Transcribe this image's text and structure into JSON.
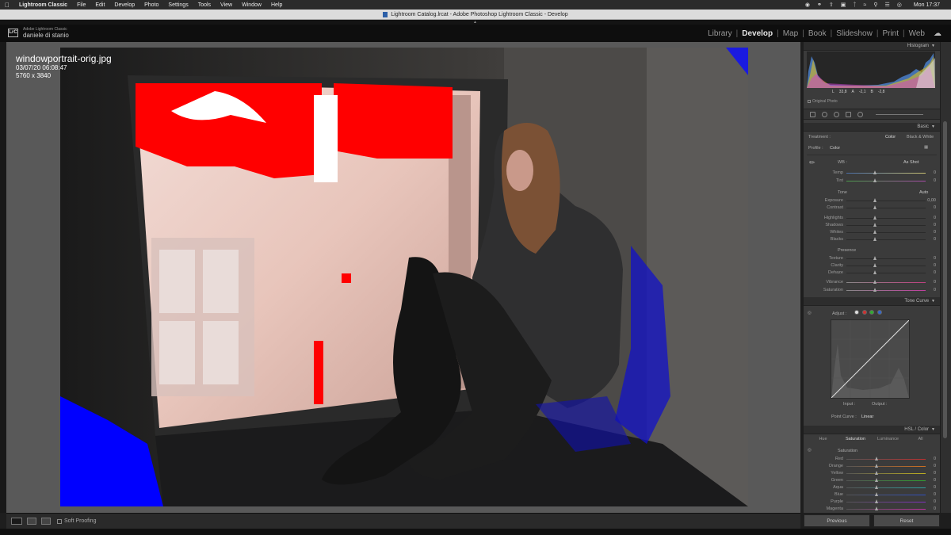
{
  "menubar": {
    "app": "Lightroom Classic",
    "items": [
      "File",
      "Edit",
      "Develop",
      "Photo",
      "Settings",
      "Tools",
      "View",
      "Window",
      "Help"
    ],
    "clock": "Mon 17:37"
  },
  "window": {
    "title": "Lightroom Catalog.lrcat - Adobe Photoshop Lightroom Classic - Develop"
  },
  "identity": {
    "badge": "LrC",
    "product": "Adobe Lightroom Classic",
    "user": "daniele di stanio"
  },
  "modules": [
    "Library",
    "Develop",
    "Map",
    "Book",
    "Slideshow",
    "Print",
    "Web"
  ],
  "active_module": "Develop",
  "photo_info": {
    "filename": "windowportrait-orig.jpg",
    "datetime": "03/07/20 06:08:47",
    "dimensions": "5760 x 3840"
  },
  "toolbar": {
    "soft_proofing": "Soft Proofing"
  },
  "histogram": {
    "title": "Histogram",
    "l_label": "L",
    "l_value": "33,8",
    "a_label": "A",
    "a_value": "-2,1",
    "b_label": "B",
    "b_value": "-2,8",
    "original_photo": "Original Photo"
  },
  "basic": {
    "title": "Basic",
    "treatment_label": "Treatment :",
    "treatment_color": "Color",
    "treatment_bw": "Black & White",
    "profile_label": "Profile :",
    "profile_value": "Color",
    "wb_label": "WB :",
    "wb_value": "As Shot",
    "tone_label": "Tone",
    "auto_label": "Auto",
    "presence_label": "Presence",
    "sliders": [
      {
        "label": "Temp",
        "value": "0"
      },
      {
        "label": "Tint",
        "value": "0"
      },
      {
        "label": "Exposure",
        "value": "0,00"
      },
      {
        "label": "Contrast",
        "value": "0"
      },
      {
        "label": "Highlights",
        "value": "0"
      },
      {
        "label": "Shadows",
        "value": "0"
      },
      {
        "label": "Whites",
        "value": "0"
      },
      {
        "label": "Blacks",
        "value": "0"
      },
      {
        "label": "Texture",
        "value": "0"
      },
      {
        "label": "Clarity",
        "value": "0"
      },
      {
        "label": "Dehaze",
        "value": "0"
      },
      {
        "label": "Vibrance",
        "value": "0"
      },
      {
        "label": "Saturation",
        "value": "0"
      }
    ]
  },
  "tone_curve": {
    "title": "Tone Curve",
    "adjust_label": "Adjust :",
    "input_label": "Input :",
    "output_label": "Output :",
    "point_curve_label": "Point Curve :",
    "point_curve_value": "Linear"
  },
  "hsl": {
    "title": "HSL / Color",
    "tabs": [
      "Hue",
      "Saturation",
      "Luminance",
      "All"
    ],
    "active_tab": "Saturation",
    "group_label": "Saturation",
    "sliders": [
      {
        "label": "Red",
        "value": "0"
      },
      {
        "label": "Orange",
        "value": "0"
      },
      {
        "label": "Yellow",
        "value": "0"
      },
      {
        "label": "Green",
        "value": "0"
      },
      {
        "label": "Aqua",
        "value": "0"
      },
      {
        "label": "Blue",
        "value": "0"
      },
      {
        "label": "Purple",
        "value": "0"
      },
      {
        "label": "Magenta",
        "value": "0"
      }
    ]
  },
  "buttons": {
    "previous": "Previous",
    "reset": "Reset"
  },
  "colors": {
    "highlight_clip": "#ff0000",
    "shadow_clip": "#0000ff",
    "panel_bg": "#3b3b3b"
  }
}
